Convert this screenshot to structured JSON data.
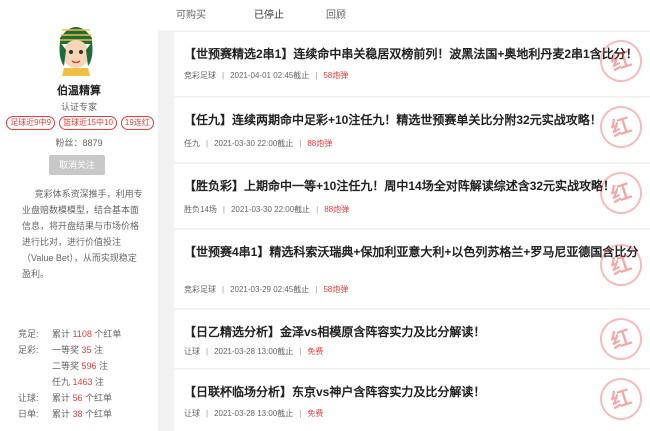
{
  "tabs": [
    "可购买",
    "已停止",
    "回顾"
  ],
  "active_tab": "已停止",
  "expert": {
    "name": "伯温精算",
    "title": "认证专家",
    "badges": [
      "足球近9中9",
      "篮球近15中10",
      "19连红"
    ],
    "fans": "粉丝：8879",
    "unfollow_label": "取消关注",
    "bio": "竞彩体系资深推手，利用专业盘赔数模模型，结合基本面信息，将开盘结果与市场价格进行比对，进行价值投注（Value Bet），从而实现稳定盈利。"
  },
  "stats": [
    {
      "cat": "竞足:",
      "label_pre": "累计 ",
      "num": "1108",
      "label_post": " 个红单"
    },
    {
      "cat": "足彩:",
      "label_pre": "一等奖 ",
      "num": "35",
      "label_post": " 注"
    },
    {
      "cat": "",
      "label_pre": "二等奖 ",
      "num": "596",
      "label_post": " 注"
    },
    {
      "cat": "",
      "label_pre": "任九 ",
      "num": "1463",
      "label_post": " 注"
    },
    {
      "cat": "让球:",
      "label_pre": "累计 ",
      "num": "56",
      "label_post": " 个红单"
    },
    {
      "cat": "日单:",
      "label_pre": "累计 ",
      "num": "38",
      "label_post": " 个红单"
    }
  ],
  "stamp_text": "红",
  "articles": [
    {
      "title": "【世预赛精选2串1】连续命中串关稳居双榜前列！波黑法国+奥地利丹麦2串1含比分！",
      "category": "竞彩足球",
      "time": "2021-04-01 02:45截止",
      "price": "58炮弹"
    },
    {
      "title": "【任九】连续两期命中足彩+10注任九！精选世预赛单关比分附32元实战攻略！",
      "category": "任九",
      "time": "2021-03-30 22:00截止",
      "price": "88炮弹"
    },
    {
      "title": "【胜负彩】上期命中一等+10注任九！周中14场全对阵解读综述含32元实战攻略！",
      "category": "胜负14场",
      "time": "2021-03-30 22:00截止",
      "price": "88炮弹"
    },
    {
      "title": "【世预赛4串1】精选科索沃瑞典+保加利亚意大利+以色列苏格兰+罗马尼亚德国含比分",
      "category": "竞彩足球",
      "time": "2021-03-29 02:45截止",
      "price": "58炮弹"
    },
    {
      "title": "【日乙精选分析】金泽vs相模原含阵容实力及比分解读！",
      "category": "让球",
      "time": "2021-03-28 13:00截止",
      "price": "免费"
    },
    {
      "title": "【日联杯临场分析】东京vs神户含阵容实力及比分解读！",
      "category": "让球",
      "time": "2021-03-28 13:00截止",
      "price": "免费"
    }
  ]
}
